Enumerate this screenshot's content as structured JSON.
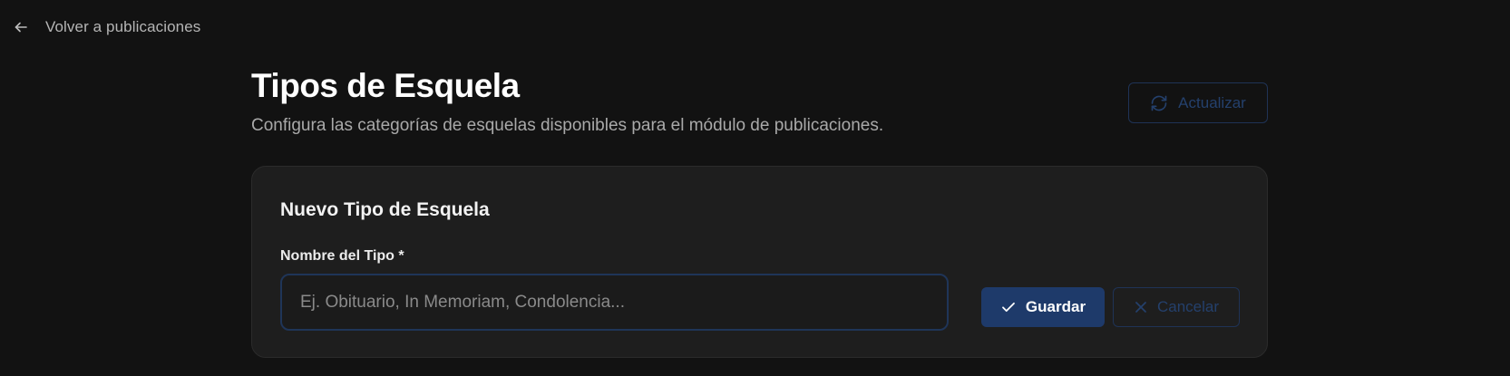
{
  "nav": {
    "back_label": "Volver a publicaciones",
    "back_icon": "arrow-left-icon"
  },
  "header": {
    "title": "Tipos de Esquela",
    "subtitle": "Configura las categorías de esquelas disponibles para el módulo de publicaciones.",
    "refresh_label": "Actualizar",
    "refresh_icon": "refresh-icon"
  },
  "form": {
    "card_title": "Nuevo Tipo de Esquela",
    "name_label": "Nombre del Tipo *",
    "name_value": "",
    "name_placeholder": "Ej. Obituario, In Memoriam, Condolencia...",
    "save_label": "Guardar",
    "save_icon": "check-icon",
    "cancel_label": "Cancelar",
    "cancel_icon": "close-icon"
  },
  "colors": {
    "background": "#121212",
    "card": "#1e1e1e",
    "accent": "#1e3a6a",
    "accent_muted": "#24406c"
  }
}
